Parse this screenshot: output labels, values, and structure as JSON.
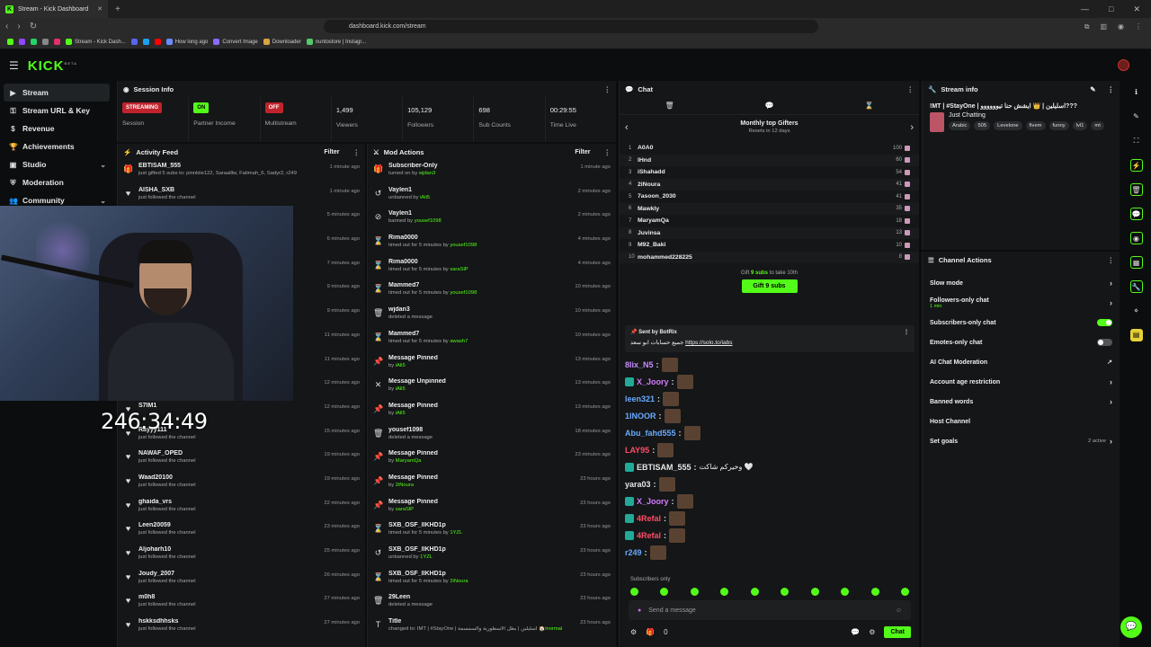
{
  "browser": {
    "tab_title": "Stream - Kick Dashboard",
    "url": "dashboard.kick.com/stream",
    "bookmarks": [
      "Stream - Kick Dash...",
      "How long ago",
      "Convert Image",
      "Downloader",
      "nuntostore | Instagr..."
    ]
  },
  "app": {
    "logo": "KICK",
    "logo_tag": "BETA"
  },
  "sidebar": {
    "items": [
      {
        "label": "Stream",
        "icon": "play-icon",
        "active": true
      },
      {
        "label": "Stream URL & Key",
        "icon": "key-icon"
      },
      {
        "label": "Revenue",
        "icon": "dollar-icon"
      },
      {
        "label": "Achievements",
        "icon": "trophy-icon"
      },
      {
        "label": "Studio",
        "icon": "studio-icon",
        "chev": "⌄"
      },
      {
        "label": "Moderation",
        "icon": "shield-icon"
      },
      {
        "label": "Community",
        "icon": "users-icon",
        "chev": "⌄"
      }
    ]
  },
  "session": {
    "title": "Session Info",
    "cells": [
      {
        "badge": "STREAMING",
        "label": "Session"
      },
      {
        "badge": "ON",
        "label": "Partner Income"
      },
      {
        "badge": "OFF",
        "label": "Multistream"
      },
      {
        "value": "1,499",
        "label": "Viewers"
      },
      {
        "value": "105,129",
        "label": "Followers"
      },
      {
        "value": "698",
        "label": "Sub Counts"
      },
      {
        "value": "00:29:55",
        "label": "Time Live"
      }
    ]
  },
  "activity": {
    "title": "Activity Feed",
    "filter": "Filter",
    "items": [
      {
        "name": "EBTISAM_555",
        "sub": "just gifted 5 subs to: pinnkiie122, Saraalllw, Fatimah_6, Sadyr2, r249",
        "time": "1 minute ago",
        "icon": "gift-icon"
      },
      {
        "name": "AISHA_SXB",
        "sub": "just followed the channel",
        "time": "1 minute ago",
        "icon": "heart-icon"
      },
      {
        "name": "",
        "sub": "",
        "time": "5 minutes ago",
        "icon": "heart-icon"
      },
      {
        "name": "",
        "sub": "",
        "time": "6 minutes ago",
        "icon": "heart-icon"
      },
      {
        "name": "",
        "sub": "",
        "time": "7 minutes ago",
        "icon": "heart-icon"
      },
      {
        "name": "",
        "sub": "",
        "time": "9 minutes ago",
        "icon": "heart-icon"
      },
      {
        "name": "",
        "sub": "",
        "time": "9 minutes ago",
        "icon": "heart-icon"
      },
      {
        "name": "",
        "sub": "",
        "time": "11 minutes ago",
        "icon": "heart-icon"
      },
      {
        "name": "",
        "sub": "",
        "time": "11 minutes ago",
        "icon": "heart-icon"
      },
      {
        "name": "",
        "sub": "",
        "time": "12 minutes ago",
        "icon": "heart-icon"
      },
      {
        "name": "S7IM1",
        "sub": "",
        "time": "12 minutes ago",
        "icon": "heart-icon"
      },
      {
        "name": "Rayyy111",
        "sub": "just followed the channel",
        "time": "15 minutes ago",
        "icon": "heart-icon"
      },
      {
        "name": "NAWAF_OPED",
        "sub": "just followed the channel",
        "time": "19 minutes ago",
        "icon": "heart-icon"
      },
      {
        "name": "Waad20100",
        "sub": "just followed the channel",
        "time": "19 minutes ago",
        "icon": "heart-icon"
      },
      {
        "name": "ghaida_vrs",
        "sub": "just followed the channel",
        "time": "22 minutes ago",
        "icon": "heart-icon"
      },
      {
        "name": "Leen20059",
        "sub": "just followed the channel",
        "time": "23 minutes ago",
        "icon": "heart-icon"
      },
      {
        "name": "Aljoharh10",
        "sub": "just followed the channel",
        "time": "25 minutes ago",
        "icon": "heart-icon"
      },
      {
        "name": "Joudy_2007",
        "sub": "just followed the channel",
        "time": "26 minutes ago",
        "icon": "heart-icon"
      },
      {
        "name": "m0h8",
        "sub": "just followed the channel",
        "time": "27 minutes ago",
        "icon": "heart-icon"
      },
      {
        "name": "hskksdhhsks",
        "sub": "just followed the channel",
        "time": "27 minutes ago",
        "icon": "heart-icon"
      }
    ]
  },
  "modactions": {
    "title": "Mod Actions",
    "filter": "Filter",
    "items": [
      {
        "name": "Subscriber-Only",
        "sub": "turned on by ",
        "by": "wjdan3",
        "time": "1 minute ago",
        "icon": "gift-icon"
      },
      {
        "name": "Vaylen1",
        "sub": "unbanned by ",
        "by": "iAli5",
        "time": "2 minutes ago",
        "icon": "undo-icon"
      },
      {
        "name": "Vaylen1",
        "sub": "banned by ",
        "by": "yousef1098",
        "time": "2 minutes ago",
        "icon": "ban-icon"
      },
      {
        "name": "Rima0000",
        "sub": "timed out for 5 minutes by ",
        "by": "yousef1098",
        "time": "4 minutes ago",
        "icon": "hourglass-icon"
      },
      {
        "name": "Rima0000",
        "sub": "timed out for 5 minutes by ",
        "by": "saraSlP",
        "time": "4 minutes ago",
        "icon": "hourglass-icon"
      },
      {
        "name": "Mammed7",
        "sub": "timed out for 5 minutes by ",
        "by": "yousef1098",
        "time": "10 minutes ago",
        "icon": "hourglass-icon"
      },
      {
        "name": "wjdan3",
        "sub": "deleted a message",
        "by": "",
        "time": "10 minutes ago",
        "icon": "trash-icon"
      },
      {
        "name": "Mammed7",
        "sub": "timed out for 5 minutes by ",
        "by": "awash7",
        "time": "10 minutes ago",
        "icon": "hourglass-icon"
      },
      {
        "name": "Message Pinned",
        "sub": "by ",
        "by": "iAli5",
        "time": "13 minutes ago",
        "icon": "pin-icon"
      },
      {
        "name": "Message Unpinned",
        "sub": "by ",
        "by": "iAli5",
        "time": "13 minutes ago",
        "icon": "unpin-icon"
      },
      {
        "name": "Message Pinned",
        "sub": "by ",
        "by": "iAli5",
        "time": "13 minutes ago",
        "icon": "pin-icon"
      },
      {
        "name": "yousef1098",
        "sub": "deleted a message",
        "by": "",
        "time": "18 minutes ago",
        "icon": "trash-icon"
      },
      {
        "name": "Message Pinned",
        "sub": "by ",
        "by": "MaryamQa",
        "time": "23 minutes ago",
        "icon": "pin-icon"
      },
      {
        "name": "Message Pinned",
        "sub": "by ",
        "by": "2iNoura",
        "time": "23 hours ago",
        "icon": "pin-icon"
      },
      {
        "name": "Message Pinned",
        "sub": "by ",
        "by": "saraSlP",
        "time": "23 hours ago",
        "icon": "pin-icon"
      },
      {
        "name": "SXB_OSF_llKHD1p",
        "sub": "timed out for 5 minutes by ",
        "by": "1YZL",
        "time": "23 hours ago",
        "icon": "hourglass-icon"
      },
      {
        "name": "SXB_OSF_llKHD1p",
        "sub": "unbanned by ",
        "by": "1YZL",
        "time": "23 hours ago",
        "icon": "undo-icon"
      },
      {
        "name": "SXB_OSF_llKHD1p",
        "sub": "timed out for 5 minutes by ",
        "by": "2iNoura",
        "time": "23 hours ago",
        "icon": "hourglass-icon"
      },
      {
        "name": "29Leen",
        "sub": "deleted a message",
        "by": "",
        "time": "23 hours ago",
        "icon": "trash-icon"
      },
      {
        "name": "Title",
        "sub": "changed to: IMT | #StayOne | اسليلين | بطل الاسطورية والسمسمة 🏠",
        "by": "inormal",
        "time": "23 hours ago",
        "icon": "edit-icon"
      }
    ]
  },
  "chat": {
    "title": "Chat",
    "gifters_title": "Monthly top Gifters",
    "gifters_reset": "Resets in 12 days",
    "gifters": [
      {
        "rank": "1",
        "name": "A0A0",
        "count": "100"
      },
      {
        "rank": "2",
        "name": "lHnd",
        "count": "60"
      },
      {
        "rank": "3",
        "name": "iShahadd",
        "count": "54"
      },
      {
        "rank": "4",
        "name": "2iNoura",
        "count": "41"
      },
      {
        "rank": "5",
        "name": "7asoon_2030",
        "count": "41"
      },
      {
        "rank": "6",
        "name": "Mawkly",
        "count": "35"
      },
      {
        "rank": "7",
        "name": "MaryamQa",
        "count": "18"
      },
      {
        "rank": "8",
        "name": "Juvinsa",
        "count": "13"
      },
      {
        "rank": "9",
        "name": "M92_Baki",
        "count": "10"
      },
      {
        "rank": "10",
        "name": "mohammed228225",
        "count": "8"
      }
    ],
    "gift_info_prefix": "Gift ",
    "gift_info_bold": "9 subs",
    "gift_info_suffix": " to take 10th",
    "gift_button": "Gift 9 subs",
    "pinned_by": "Sent by BotRix",
    "pinned_msg": "جميع حسابات ابو سعد ",
    "pinned_link": "https://solo.to/iabs",
    "lines": [
      {
        "user": "8lix_N5",
        "color": "#c58cff",
        "text": ""
      },
      {
        "user": "X_Joory",
        "color": "#d57bff",
        "text": ""
      },
      {
        "user": "leen321",
        "color": "#6aa9ff",
        "text": ""
      },
      {
        "user": "1INOOR",
        "color": "#6aa9ff",
        "text": ""
      },
      {
        "user": "Abu_fahd555",
        "color": "#6aa9ff",
        "text": ""
      },
      {
        "user": "LAY95",
        "color": "#ff4d6a",
        "text": ""
      },
      {
        "user": "EBTISAM_555",
        "color": "#e6e6e6",
        "text": "وخيركم شاكت 🤍"
      },
      {
        "user": "yara03",
        "color": "#e6e6e6",
        "text": ""
      },
      {
        "user": "X_Joory",
        "color": "#d57bff",
        "text": ""
      },
      {
        "user": "4Refal",
        "color": "#ff4d6a",
        "text": ""
      },
      {
        "user": "4Refal",
        "color": "#ff4d6a",
        "text": ""
      },
      {
        "user": "r249",
        "color": "#6aa9ff",
        "text": ""
      }
    ],
    "subs_only": "Subscribers only",
    "input_placeholder": "Send a message",
    "points": "0",
    "send_button": "Chat"
  },
  "streaminfo": {
    "title": "Stream info",
    "stream_title": "!MT | #StayOne | اسليلين | 👑 ايشش حنا تيوووووو???",
    "category": "Just Chatting",
    "tags": [
      "Arabic",
      "505",
      "Levelone",
      "fivem",
      "funny",
      "lvl1",
      "mt"
    ]
  },
  "channelactions": {
    "title": "Channel Actions",
    "rows": [
      {
        "label": "Slow mode",
        "kind": "chev"
      },
      {
        "label": "Followers-only chat",
        "sub": "1 min",
        "kind": "chev"
      },
      {
        "label": "Subscribers-only chat",
        "kind": "toggle-on"
      },
      {
        "label": "Emotes-only chat",
        "kind": "toggle-off"
      },
      {
        "label": "AI Chat Moderation",
        "kind": "ext"
      },
      {
        "label": "Account age restriction",
        "kind": "chev"
      },
      {
        "label": "Banned words",
        "kind": "chev"
      },
      {
        "label": "Host Channel",
        "kind": "none"
      },
      {
        "label": "Set goals",
        "kind": "chev",
        "active": "2 active"
      }
    ]
  },
  "overlay": {
    "timer": "246:34:49"
  }
}
